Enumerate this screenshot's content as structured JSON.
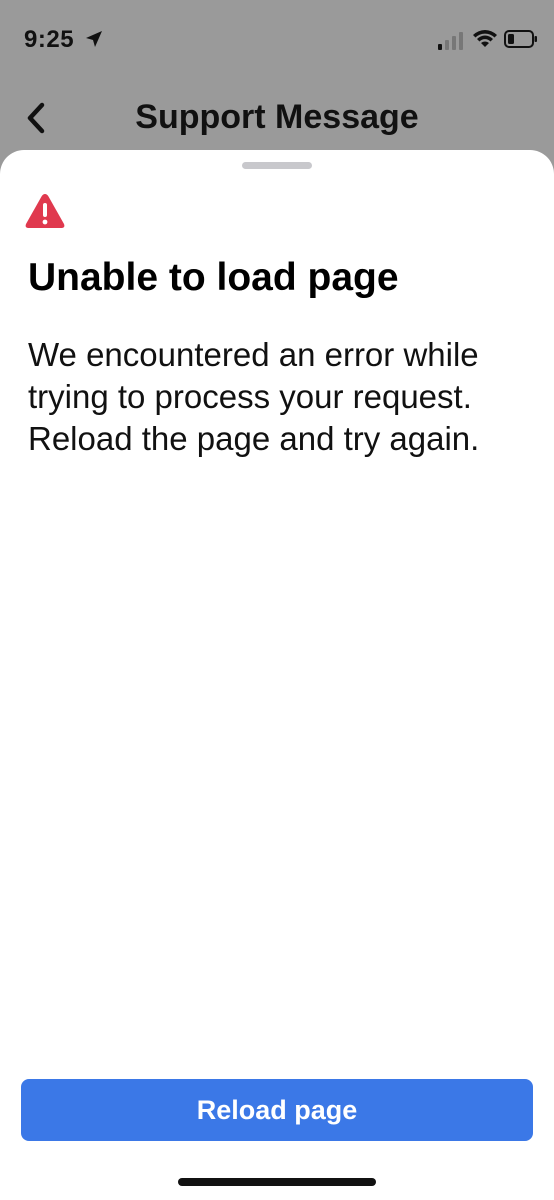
{
  "status_bar": {
    "time": "9:25"
  },
  "nav": {
    "title": "Support Message"
  },
  "error": {
    "title": "Unable to load page",
    "message": "We encountered an error while trying to process your request. Reload the page and try again."
  },
  "actions": {
    "reload_label": "Reload page"
  },
  "colors": {
    "accent": "#3b78e7",
    "warning": "#e0394e",
    "dim_background": "#9a9a9a"
  },
  "icons": {
    "back": "chevron-left-icon",
    "warning": "warning-triangle-icon",
    "location": "location-arrow-icon",
    "signal": "cellular-signal-icon",
    "wifi": "wifi-icon",
    "battery": "battery-icon"
  }
}
